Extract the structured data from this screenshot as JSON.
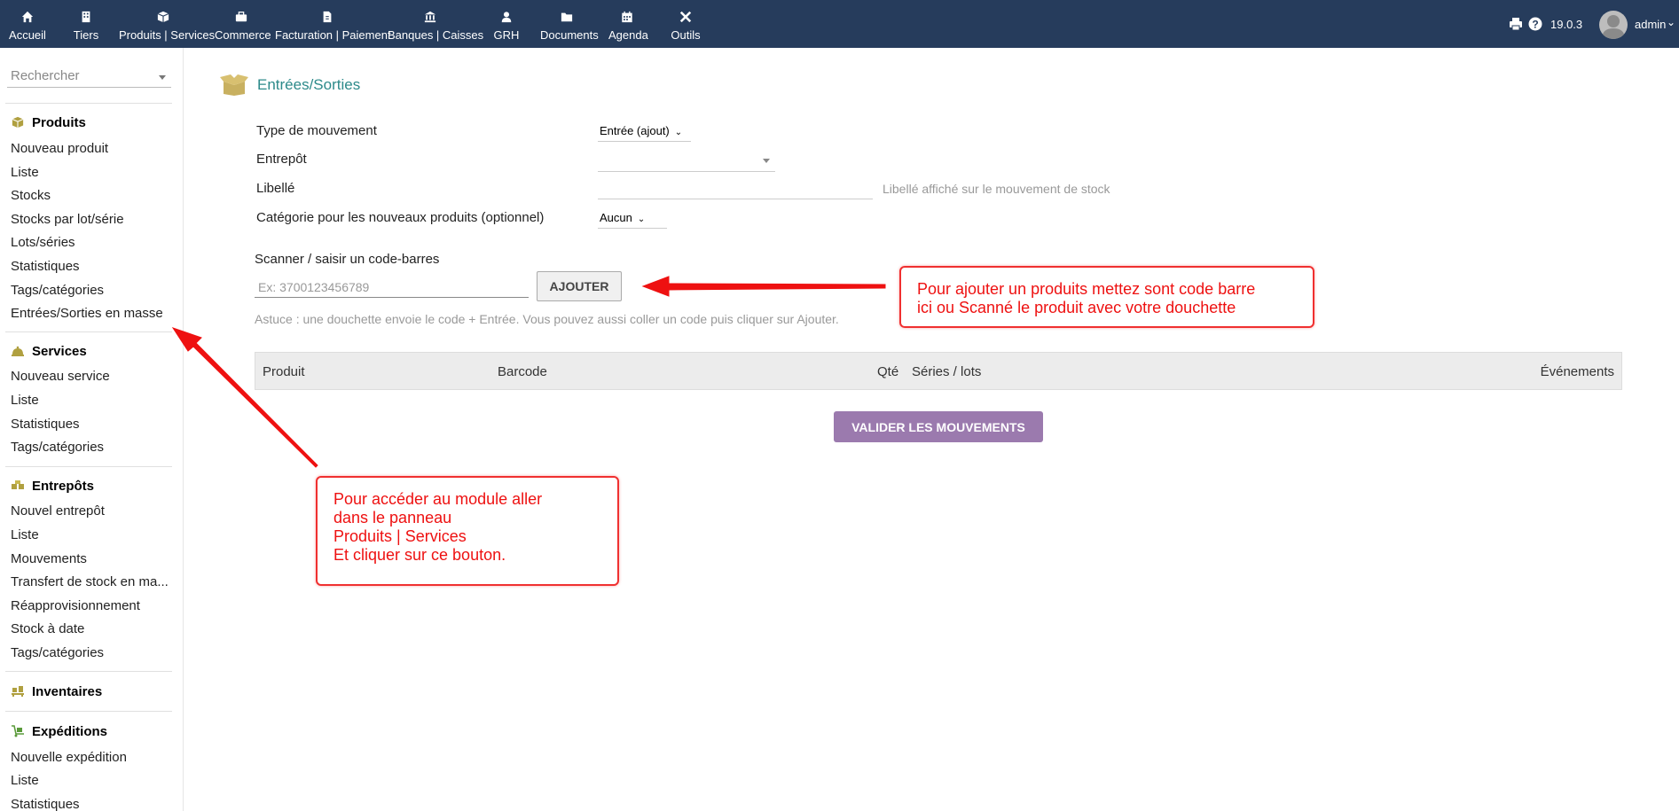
{
  "topbar": {
    "menu": [
      {
        "label": "Accueil",
        "icon": "home-icon"
      },
      {
        "label": "Tiers",
        "icon": "building-icon"
      },
      {
        "label": "Produits | Services",
        "icon": "cube-icon"
      },
      {
        "label": "Commerce",
        "icon": "briefcase-icon"
      },
      {
        "label": "Facturation | Paiement",
        "icon": "invoice-icon"
      },
      {
        "label": "Banques | Caisses",
        "icon": "bank-icon"
      },
      {
        "label": "GRH",
        "icon": "user-icon"
      },
      {
        "label": "Documents",
        "icon": "folder-icon"
      },
      {
        "label": "Agenda",
        "icon": "calendar-icon"
      },
      {
        "label": "Outils",
        "icon": "tools-icon"
      }
    ],
    "version": "19.0.3",
    "user": "admin"
  },
  "sidebar": {
    "search_placeholder": "Rechercher",
    "sections": [
      {
        "title": "Produits",
        "icon": "cube-icon",
        "items": [
          "Nouveau produit",
          "Liste",
          "Stocks",
          "Stocks par lot/série",
          "Lots/séries",
          "Statistiques",
          "Tags/catégories",
          "Entrées/Sorties en masse"
        ]
      },
      {
        "title": "Services",
        "icon": "bell-icon",
        "items": [
          "Nouveau service",
          "Liste",
          "Statistiques",
          "Tags/catégories"
        ]
      },
      {
        "title": "Entrepôts",
        "icon": "boxes-icon",
        "items": [
          "Nouvel entrepôt",
          "Liste",
          "Mouvements",
          "Transfert de stock en ma...",
          "Réapprovisionnement",
          "Stock à date",
          "Tags/catégories"
        ]
      },
      {
        "title": "Inventaires",
        "icon": "pallet-icon",
        "items": []
      },
      {
        "title": "Expéditions",
        "icon": "dolly-icon",
        "items": [
          "Nouvelle expédition",
          "Liste",
          "Statistiques"
        ]
      }
    ]
  },
  "page": {
    "title": "Entrées/Sorties",
    "form": {
      "movement_type_label": "Type de mouvement",
      "movement_type_value": "Entrée (ajout)",
      "warehouse_label": "Entrepôt",
      "warehouse_value": "",
      "libelle_label": "Libellé",
      "libelle_value": "",
      "libelle_hint": "Libellé affiché sur le mouvement de stock",
      "category_label": "Catégorie pour les nouveaux produits (optionnel)",
      "category_value": "Aucun"
    },
    "scan": {
      "label": "Scanner / saisir un code-barres",
      "placeholder": "Ex: 3700123456789",
      "add_button": "AJOUTER",
      "tip": "Astuce : une douchette envoie le code + Entrée. Vous pouvez aussi coller un code puis cliquer sur Ajouter."
    },
    "table_headers": [
      "Produit",
      "Barcode",
      "Qté",
      "Séries / lots",
      "Événements"
    ],
    "validate_button": "VALIDER LES MOUVEMENTS"
  },
  "annotations": {
    "barcode_callout": [
      "Pour ajouter un produits mettez sont code barre",
      "ici ou Scanné le produit avec votre douchette"
    ],
    "menu_callout": [
      "Pour accéder au module aller",
      "dans le panneau",
      "Produits | Services",
      "Et cliquer sur ce bouton."
    ]
  },
  "colors": {
    "topbar": "#263c5c",
    "accent_title": "#2d8a8a",
    "validate_button": "#9b7aae",
    "annotation_red": "#f03030"
  }
}
